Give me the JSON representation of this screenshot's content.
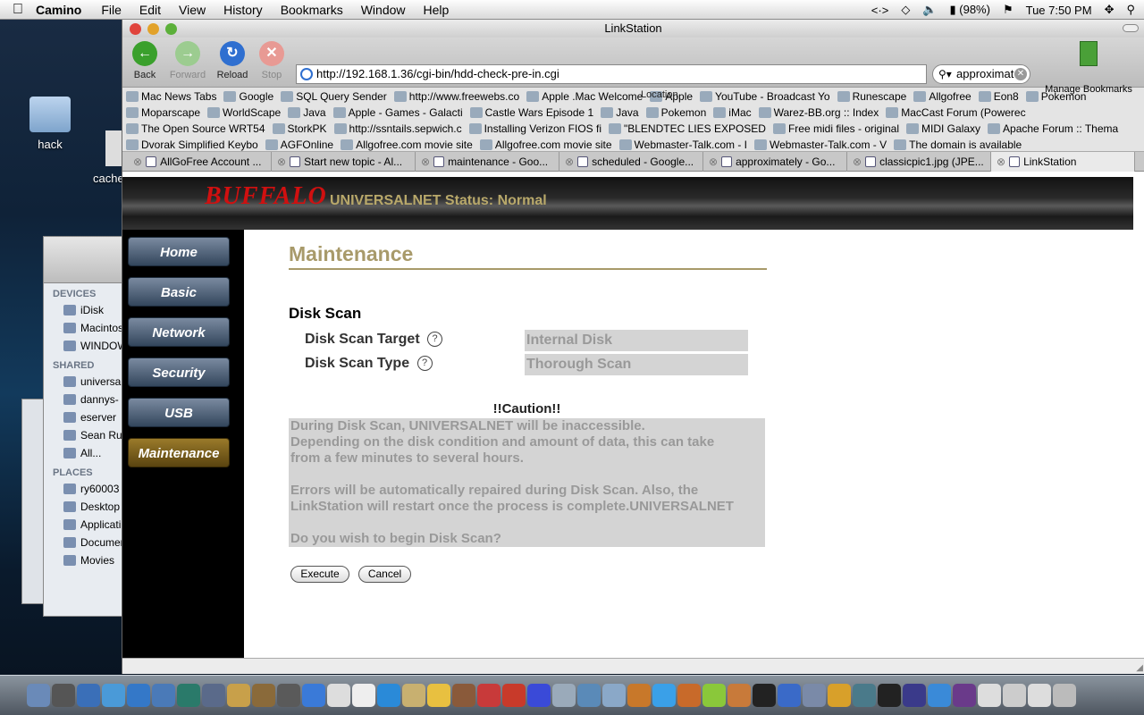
{
  "menubar": {
    "app_name": "Camino",
    "menus": [
      "File",
      "Edit",
      "View",
      "History",
      "Bookmarks",
      "Window",
      "Help"
    ],
    "battery": "(98%)",
    "clock": "Tue 7:50 PM"
  },
  "desktop": {
    "icon_hack": "hack",
    "icon_cache": "cache"
  },
  "finder": {
    "devices_header": "DEVICES",
    "devices": [
      "iDisk",
      "Macintos",
      "WINDOW"
    ],
    "shared_header": "SHARED",
    "shared": [
      "universa",
      "dannys-",
      "eserver",
      "Sean Rule",
      "All..."
    ],
    "places_header": "PLACES",
    "places": [
      "ry60003",
      "Desktop",
      "Applicati",
      "Documen",
      "Movies"
    ]
  },
  "browser": {
    "window_title": "LinkStation",
    "toolbar": {
      "back": "Back",
      "forward": "Forward",
      "reload": "Reload",
      "stop": "Stop",
      "url": "http://192.168.1.36/cgi-bin/hdd-check-pre-in.cgi",
      "location_label": "Location",
      "search_value": "approximat",
      "manage_bookmarks": "Manage Bookmarks"
    },
    "bookmarks": [
      [
        "Mac News Tabs",
        "Google",
        "SQL Query Sender",
        "http://www.freewebs.co",
        "Apple .Mac Welcome",
        "Apple",
        "YouTube - Broadcast Yo",
        "Runescape",
        "Allgofree",
        "Eon8",
        "Pokemon"
      ],
      [
        "Moparscape",
        "WorldScape",
        "Java",
        "Apple - Games - Galacti",
        "Castle Wars Episode 1",
        "Java",
        "Pokemon",
        "iMac",
        "Warez-BB.org :: Index",
        "MacCast Forum (Powerec"
      ],
      [
        "The Open Source WRT54",
        "StorkPK",
        "http://ssntails.sepwich.c",
        "Installing Verizon FIOS fi",
        "\"BLENDTEC LIES EXPOSED",
        "Free midi files - original",
        "MIDI Galaxy",
        "Apache Forum :: Thema"
      ],
      [
        "Dvorak Simplified Keybo",
        "AGFOnline",
        "Allgofree.com movie site",
        "Allgofree.com movie site",
        "Webmaster-Talk.com - I",
        "Webmaster-Talk.com - V",
        "The domain is available"
      ]
    ],
    "tabs": [
      "AllGoFree Account ...",
      "Start new topic - Al...",
      "maintenance - Goo...",
      "scheduled - Google...",
      "approximately - Go...",
      "classicpic1.jpg (JPE...",
      "LinkStation"
    ]
  },
  "page": {
    "logo": "BUFFALO",
    "status": "UNIVERSALNET Status: Normal",
    "nav": [
      "Home",
      "Basic",
      "Network",
      "Security",
      "USB",
      "Maintenance"
    ],
    "title": "Maintenance",
    "section": "Disk Scan",
    "target_label": "Disk Scan Target",
    "target_value": "Internal Disk",
    "type_label": "Disk Scan Type",
    "type_value": "Thorough Scan",
    "help_glyph": "?",
    "caution_title": "!!Caution!!",
    "caution_lines": [
      "During Disk Scan, UNIVERSALNET will be inaccessible.",
      "Depending on the disk condition and amount of data, this can take",
      "from a few minutes to several hours.",
      "Errors will be automatically repaired during Disk Scan. Also, the",
      "LinkStation will restart once the process is complete.UNIVERSALNET",
      "Do you wish to begin Disk Scan?"
    ],
    "execute": "Execute",
    "cancel": "Cancel"
  },
  "colors": {
    "accent_gold": "#a89a6a",
    "buffalo_red": "#d01010",
    "nav_active": "#9a7a2a"
  }
}
